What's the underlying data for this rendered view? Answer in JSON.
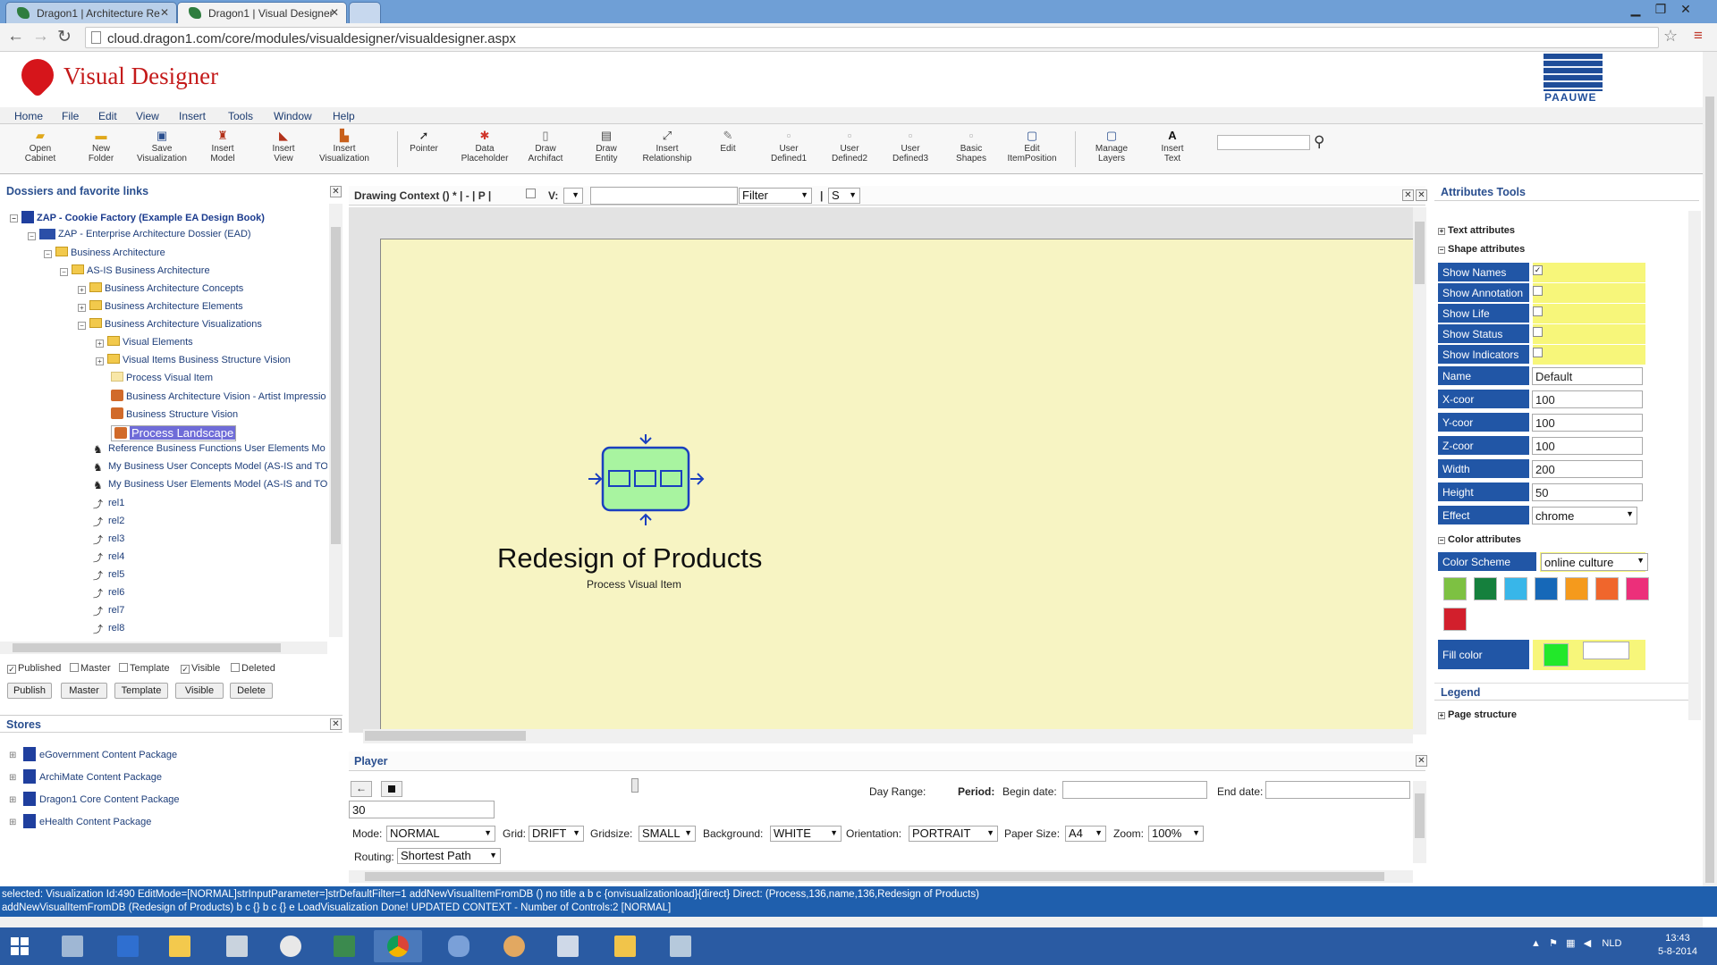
{
  "browser": {
    "tabs": [
      {
        "title": "Dragon1 | Architecture Re",
        "active": false
      },
      {
        "title": "Dragon1 | Visual Designer",
        "active": true
      }
    ],
    "url": "cloud.dragon1.com/core/modules/visualdesigner/visualdesigner.aspx"
  },
  "app": {
    "title": "Visual Designer",
    "partner_logo_text": "PAAUWE"
  },
  "menu": [
    "Home",
    "File",
    "Edit",
    "View",
    "Insert",
    "Tools",
    "Window",
    "Help"
  ],
  "toolbar": [
    {
      "l1": "Open",
      "l2": "Cabinet",
      "icon": "cabinet-icon"
    },
    {
      "l1": "New",
      "l2": "Folder",
      "icon": "folder-icon"
    },
    {
      "l1": "Save",
      "l2": "Visualization",
      "icon": "save-icon"
    },
    {
      "l1": "Insert",
      "l2": "Model",
      "icon": "model-icon"
    },
    {
      "l1": "Insert",
      "l2": "View",
      "icon": "view-icon"
    },
    {
      "l1": "Insert",
      "l2": "Visualization",
      "icon": "visualization-icon"
    },
    {
      "l1": "Pointer",
      "l2": "",
      "icon": "pointer-icon"
    },
    {
      "l1": "Data",
      "l2": "Placeholder",
      "icon": "placeholder-icon"
    },
    {
      "l1": "Draw",
      "l2": "Archifact",
      "icon": "archifact-icon"
    },
    {
      "l1": "Draw",
      "l2": "Entity",
      "icon": "entity-icon"
    },
    {
      "l1": "Insert",
      "l2": "Relationship",
      "icon": "relationship-icon"
    },
    {
      "l1": "Edit",
      "l2": "",
      "icon": "edit-icon"
    },
    {
      "l1": "User",
      "l2": "Defined1",
      "icon": "user-defined-icon"
    },
    {
      "l1": "User",
      "l2": "Defined2",
      "icon": "user-defined-icon"
    },
    {
      "l1": "User",
      "l2": "Defined3",
      "icon": "user-defined-icon"
    },
    {
      "l1": "Basic",
      "l2": "Shapes",
      "icon": "shapes-icon"
    },
    {
      "l1": "Edit",
      "l2": "ItemPosition",
      "icon": "position-icon"
    },
    {
      "l1": "Manage",
      "l2": "Layers",
      "icon": "layers-icon"
    },
    {
      "l1": "Insert",
      "l2": "Text",
      "icon": "text-icon"
    }
  ],
  "dossiers": {
    "title": "Dossiers and favorite links",
    "tree": [
      {
        "label": "ZAP - Cookie Factory (Example EA Design Book)",
        "icon": "book",
        "bold": true
      },
      {
        "label": "ZAP - Enterprise Architecture Dossier (EAD)",
        "icon": "dossier"
      },
      {
        "label": "Business Architecture",
        "icon": "folder"
      },
      {
        "label": "AS-IS Business Architecture",
        "icon": "folder"
      },
      {
        "label": "Business Architecture Concepts",
        "icon": "folder"
      },
      {
        "label": "Business Architecture Elements",
        "icon": "folder"
      },
      {
        "label": "Business Architecture Visualizations",
        "icon": "folder"
      },
      {
        "label": "Visual Elements",
        "icon": "folder"
      },
      {
        "label": "Visual Items Business Structure Vision",
        "icon": "folder"
      },
      {
        "label": "Process Visual Item",
        "icon": "item"
      },
      {
        "label": "Business Architecture Vision - Artist Impressio",
        "icon": "vis"
      },
      {
        "label": "Business Structure Vision",
        "icon": "vis"
      },
      {
        "label": "Process Landscape",
        "icon": "vis",
        "selected": true
      },
      {
        "label": "Reference Business Functions User Elements Mo",
        "icon": "model"
      },
      {
        "label": "My Business User Concepts Model (AS-IS and TO",
        "icon": "model"
      },
      {
        "label": "My Business User Elements Model (AS-IS and TO",
        "icon": "model"
      },
      {
        "label": "rel1",
        "icon": "rel"
      },
      {
        "label": "rel2",
        "icon": "rel"
      },
      {
        "label": "rel3",
        "icon": "rel"
      },
      {
        "label": "rel4",
        "icon": "rel"
      },
      {
        "label": "rel5",
        "icon": "rel"
      },
      {
        "label": "rel6",
        "icon": "rel"
      },
      {
        "label": "rel7",
        "icon": "rel"
      },
      {
        "label": "rel8",
        "icon": "rel"
      }
    ],
    "checkboxes": [
      {
        "label": "Published",
        "checked": true
      },
      {
        "label": "Master",
        "checked": false
      },
      {
        "label": "Template",
        "checked": false
      },
      {
        "label": "Visible",
        "checked": true
      },
      {
        "label": "Deleted",
        "checked": false
      }
    ],
    "buttons": [
      "Publish",
      "Master",
      "Template",
      "Visible",
      "Delete"
    ]
  },
  "stores": {
    "title": "Stores",
    "items": [
      "eGovernment Content Package",
      "ArchiMate Content Package",
      "Dragon1 Core Content Package",
      "eHealth Content Package"
    ]
  },
  "drawing_context": {
    "label": "Drawing Context () * | - | P |",
    "v_label": "V:",
    "filter": "Filter",
    "s_value": "S",
    "pipe": "|"
  },
  "canvas": {
    "item_name": "Redesign of Products",
    "item_type": "Process Visual Item",
    "item_fill": "#a8f4a0",
    "item_stroke": "#1a3fbf"
  },
  "player": {
    "title": "Player",
    "back_icon": "←",
    "day_range_label": "Day Range:",
    "period_label": "Period:",
    "begin_label": "Begin date:",
    "end_label": "End date:",
    "day_value": "30",
    "fields": [
      {
        "label": "Mode:",
        "value": "NORMAL"
      },
      {
        "label": "Grid:",
        "value": "DRIFT"
      },
      {
        "label": "Gridsize:",
        "value": "SMALL"
      },
      {
        "label": "Background:",
        "value": "WHITE"
      },
      {
        "label": "Orientation:",
        "value": "PORTRAIT"
      },
      {
        "label": "Paper Size:",
        "value": "A4"
      },
      {
        "label": "Zoom:",
        "value": "100%"
      }
    ],
    "routing_label": "Routing:",
    "routing_value": "Shortest Path"
  },
  "status": {
    "line1": "selected: Visualization Id:490 EditMode=[NORMAL]strInputParameter=]strDefaultFilter=1 addNewVisualItemFromDB () no title a b c {onvisualizationload}{direct} Direct: (Process,136,name,136,Redesign of Products)",
    "line2": "addNewVisualItemFromDB (Redesign of Products) b c {} b c {} e LoadVisualization Done! UPDATED CONTEXT - Number of Controls:2 [NORMAL]"
  },
  "attributes": {
    "title": "Attributes Tools",
    "text_attributes": "Text attributes",
    "shape_attributes": "Shape attributes",
    "toggles": [
      {
        "label": "Show Names",
        "checked": true
      },
      {
        "label": "Show Annotation",
        "checked": false
      },
      {
        "label": "Show Life",
        "checked": false
      },
      {
        "label": "Show Status",
        "checked": false
      },
      {
        "label": "Show Indicators",
        "checked": false
      }
    ],
    "fields": [
      {
        "label": "Name",
        "value": "Default"
      },
      {
        "label": "X-coor",
        "value": "100"
      },
      {
        "label": "Y-coor",
        "value": "100"
      },
      {
        "label": "Z-coor",
        "value": "100"
      },
      {
        "label": "Width",
        "value": "200"
      },
      {
        "label": "Height",
        "value": "50"
      }
    ],
    "effect_label": "Effect",
    "effect_value": "chrome",
    "color_attributes": "Color attributes",
    "color_scheme_label": "Color Scheme",
    "color_scheme_value": "online culture",
    "swatches": [
      "#7dc142",
      "#15803d",
      "#38b6e9",
      "#1668b8",
      "#f59a1c",
      "#f0662c",
      "#ec2f7a",
      "#d21f2c"
    ],
    "fill_color_label": "Fill color",
    "fill_color": "#22e82a",
    "legend": "Legend",
    "page_structure": "Page structure"
  },
  "taskbar": {
    "tray_text": "NLD",
    "time": "13:43",
    "date": "5-8-2014"
  }
}
